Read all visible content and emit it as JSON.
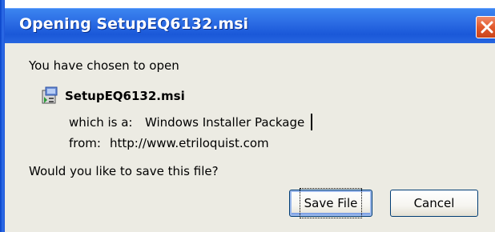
{
  "window": {
    "title": "Opening SetupEQ6132.msi"
  },
  "dialog": {
    "intro": "You have chosen to open",
    "file_name": "SetupEQ6132.msi",
    "type_label": "which is a:",
    "type_value": "Windows Installer Package",
    "from_label": "from:",
    "from_value": "http://www.etriloquist.com",
    "question": "Would you like to save this file?"
  },
  "buttons": {
    "save_label": "Save File",
    "cancel_label": "Cancel"
  },
  "icons": {
    "close": "close-icon",
    "file": "msi-package-icon"
  },
  "colors": {
    "titlebar": "#2a6ae3",
    "close_button": "#e25a2c",
    "content_background": "#ecebe3"
  }
}
